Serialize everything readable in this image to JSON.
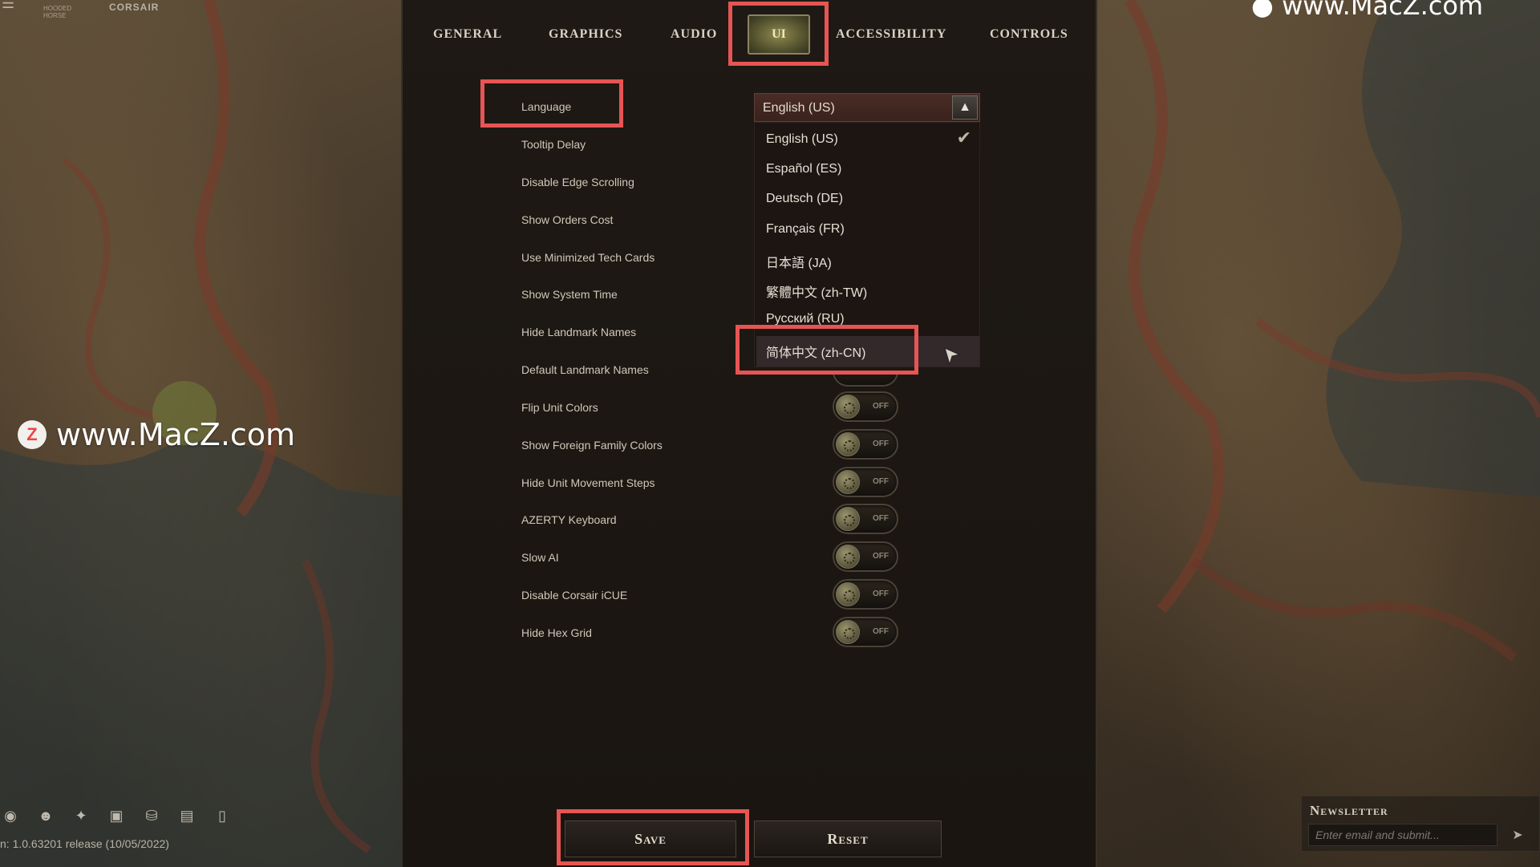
{
  "brand": {
    "corsair": "CORSAIR",
    "hooded_horse": "HOODED HORSE",
    "menu_icon": "menu-icon"
  },
  "watermark": {
    "logo": "Z",
    "text": "www.MacZ.com",
    "top_right": "www.MacZ.com"
  },
  "tabs": [
    {
      "label": "GENERAL"
    },
    {
      "label": "GRAPHICS"
    },
    {
      "label": "AUDIO"
    },
    {
      "label": "UI",
      "active": true
    },
    {
      "label": "ACCESSIBILITY"
    },
    {
      "label": "CONTROLS"
    }
  ],
  "settings": [
    {
      "label": "Language"
    },
    {
      "label": "Tooltip Delay"
    },
    {
      "label": "Disable Edge Scrolling"
    },
    {
      "label": "Show Orders Cost"
    },
    {
      "label": "Use Minimized Tech Cards"
    },
    {
      "label": "Show System Time"
    },
    {
      "label": "Hide Landmark Names"
    },
    {
      "label": "Default Landmark Names"
    },
    {
      "label": "Flip Unit Colors",
      "value": "OFF"
    },
    {
      "label": "Show Foreign Family Colors",
      "value": "OFF"
    },
    {
      "label": "Hide Unit Movement Steps",
      "value": "OFF"
    },
    {
      "label": "AZERTY Keyboard",
      "value": "OFF"
    },
    {
      "label": "Slow AI",
      "value": "OFF"
    },
    {
      "label": "Disable Corsair iCUE",
      "value": "OFF"
    },
    {
      "label": "Hide Hex Grid",
      "value": "OFF"
    }
  ],
  "language_dropdown": {
    "selected": "English (US)",
    "options": [
      "English (US)",
      "Español (ES)",
      "Deutsch (DE)",
      "Français (FR)",
      "日本語 (JA)",
      "繁體中文 (zh-TW)",
      "Русский (RU)",
      "简体中文 (zh-CN)"
    ],
    "checked_index": 0,
    "hovered_index": 7
  },
  "buttons": {
    "save": "Save",
    "reset": "Reset"
  },
  "social_icons": [
    "discord-icon",
    "reddit-icon",
    "twitter-icon",
    "twitch-icon",
    "steam-icon",
    "chat-icon",
    "book-icon"
  ],
  "version": "n: 1.0.63201 release (10/05/2022)",
  "newsletter": {
    "title": "Newsletter",
    "placeholder": "Enter email and submit..."
  },
  "colors": {
    "highlight": "#e65553",
    "panel": "#1c1712",
    "dropdown_header": "#3f2621"
  }
}
